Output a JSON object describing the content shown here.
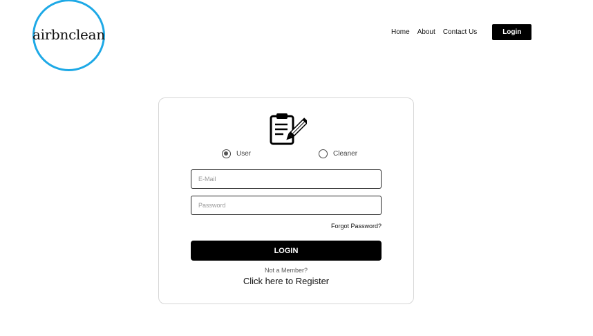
{
  "brand": {
    "name": "airbnclean",
    "ring_color": "#1ea9e6"
  },
  "nav": {
    "links": [
      "Home",
      "About",
      "Contact Us"
    ],
    "login_label": "Login"
  },
  "form": {
    "icon": "clipboard-pencil-icon",
    "roles": [
      {
        "label": "User",
        "selected": true
      },
      {
        "label": "Cleaner",
        "selected": false
      }
    ],
    "email_placeholder": "E-Mail",
    "password_placeholder": "Password",
    "forgot_label": "Forgot Password?",
    "submit_label": "LOGIN",
    "not_member_text": "Not a Member?",
    "register_label": "Click here to Register"
  }
}
